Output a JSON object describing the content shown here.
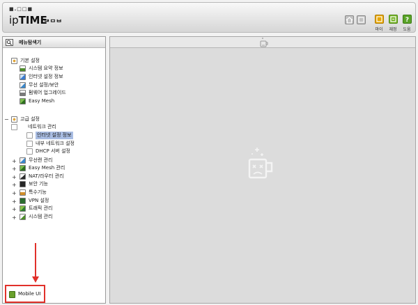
{
  "header": {
    "logo_dots": "■.□□■",
    "logo_prefix": "ip",
    "logo_main": "TIME",
    "logo_sub": "ᄃᄅᄆᄇ",
    "buttons": [
      {
        "name": "home",
        "icon": "home-icon",
        "label": ""
      },
      {
        "name": "back",
        "icon": "back-icon",
        "label": ""
      },
      {
        "name": "easy",
        "icon": "easy-mode-icon",
        "label": "마이",
        "color": "#e8a600"
      },
      {
        "name": "detail",
        "icon": "detail-mode-icon",
        "label": "재정",
        "color": "#78b52a"
      },
      {
        "name": "help",
        "icon": "help-icon",
        "label": "도움",
        "color": "#5aa328"
      }
    ]
  },
  "sidebar": {
    "title": "메뉴탐색기",
    "basic": {
      "label": "기본 설정",
      "items": [
        "시스템 요약 정보",
        "인터넷 설정 정보",
        "무선 설정/보안",
        "펌웨어 업그레이드",
        "Easy Mesh"
      ]
    },
    "advanced": {
      "label": "고급 설정",
      "network": {
        "label": "네트워크 관리",
        "items": [
          "인터넷 설정 정보",
          "내부 네트워크 설정",
          "DHCP 서버 설정"
        ],
        "selected_index": 0
      },
      "groups": [
        "무선랜 관리",
        "Easy Mesh 관리",
        "NAT/라우터 관리",
        "보안 기능",
        "특수기능",
        "VPN 설정",
        "트래픽 관리",
        "시스템 관리"
      ]
    },
    "expand_symbol": "+",
    "collapse_symbol": "−",
    "mobile": {
      "label": "Mobile UI"
    }
  },
  "colors": {
    "highlight": "#e1302a",
    "selection": "#a9bde3",
    "panel_bg": "#dcdcdc"
  }
}
